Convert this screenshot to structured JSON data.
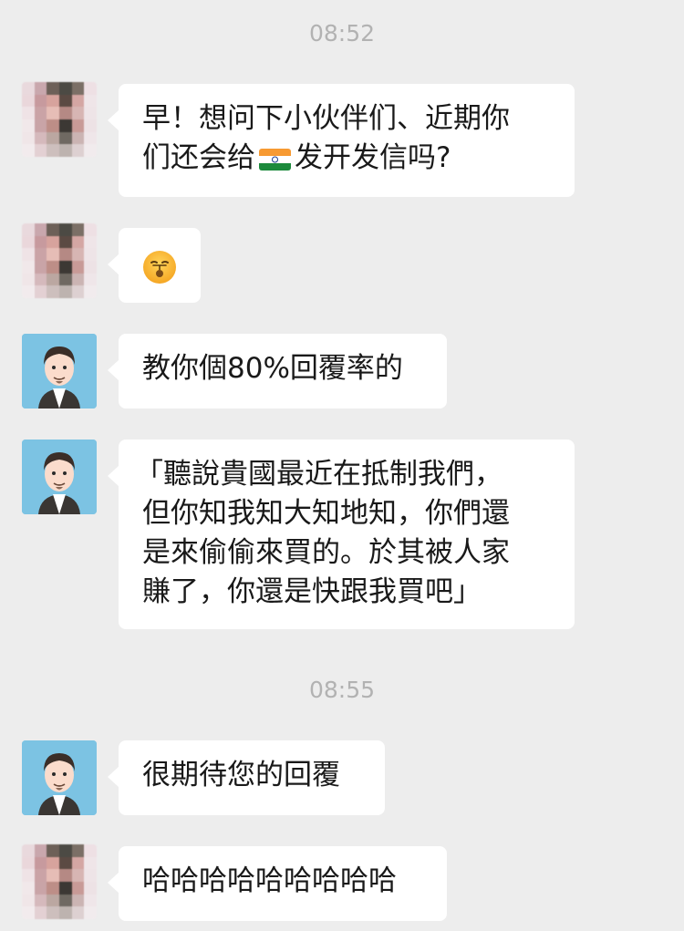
{
  "timestamps": [
    "08:52",
    "08:55"
  ],
  "messages": [
    {
      "lines_before_flag": [
        "早！想问下小伙伴们、近期你"
      ],
      "line2_before_flag": "们还会给",
      "line2_after_flag": "发开发信吗?",
      "flag_icon": "india-flag-icon",
      "sender": "contact"
    },
    {
      "emoji_icon": "face-with-thermometer-hush-icon",
      "sender": "contact"
    },
    {
      "text": "教你個80%回覆率的",
      "sender": "me"
    },
    {
      "lines": [
        "「聽說貴國最近在抵制我們，",
        "但你知我知大知地知，你們還",
        "是來偷偷來買的。於其被人家",
        "賺了，你還是快跟我買吧」"
      ],
      "sender": "me"
    },
    {
      "text": "很期待您的回覆",
      "sender": "me"
    },
    {
      "text": "哈哈哈哈哈哈哈哈哈",
      "sender": "contact"
    }
  ],
  "colors": {
    "background": "#ededed",
    "bubble": "#ffffff",
    "timestamp": "#b2b2b2",
    "avatar_bg": "#7cc3e3"
  }
}
